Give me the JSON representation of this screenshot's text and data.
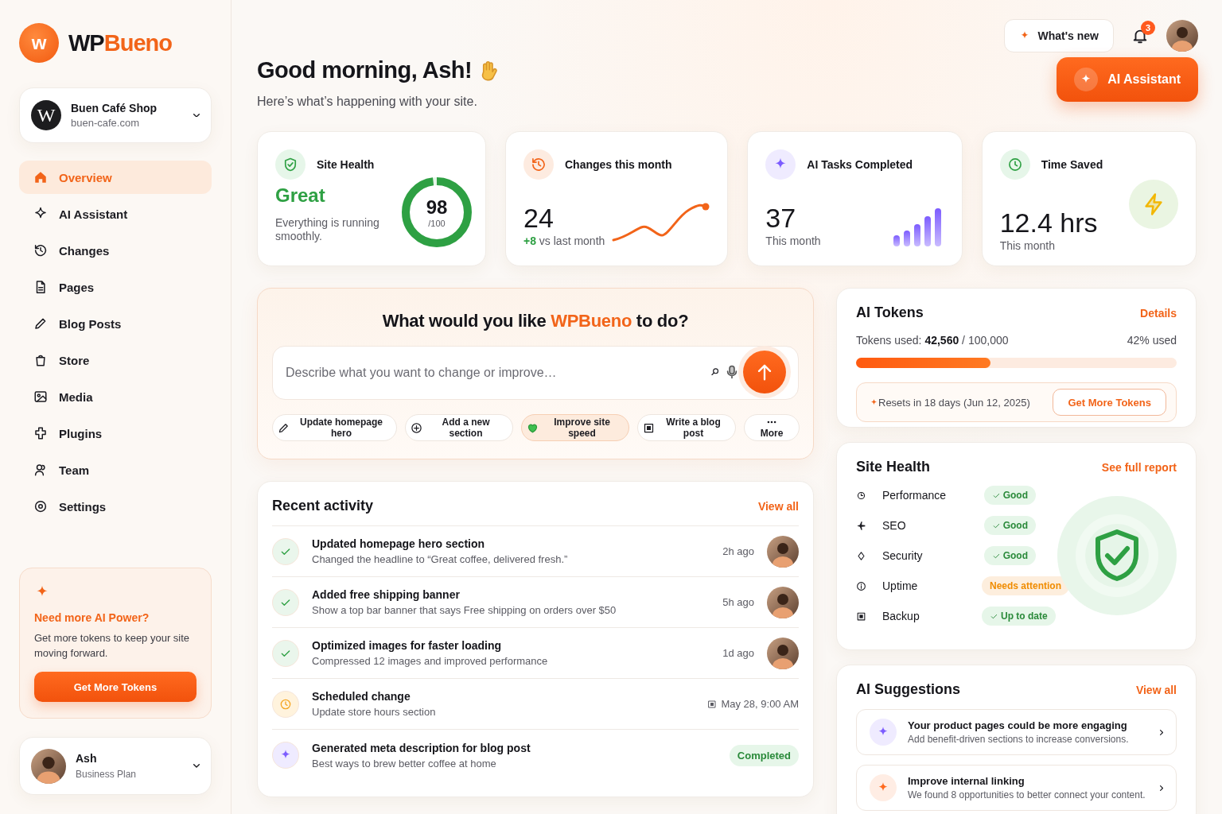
{
  "brand": {
    "logo_letter": "w",
    "name_dark": "WP",
    "name_accent": "Bueno"
  },
  "site": {
    "letter": "W",
    "name": "Buen Café Shop",
    "domain": "buen-cafe.com"
  },
  "nav": [
    {
      "label": "Overview",
      "selected": true
    },
    {
      "label": "AI Assistant",
      "selected": false
    },
    {
      "label": "Changes",
      "selected": false
    },
    {
      "label": "Pages",
      "selected": false
    },
    {
      "label": "Blog Posts",
      "selected": false
    },
    {
      "label": "Store",
      "selected": false
    },
    {
      "label": "Media",
      "selected": false
    },
    {
      "label": "Plugins",
      "selected": false
    },
    {
      "label": "Team",
      "selected": false
    },
    {
      "label": "Settings",
      "selected": false
    }
  ],
  "promo": {
    "title": "Need more AI Power?",
    "text": "Get more tokens to keep your site moving forward.",
    "button": "Get More Tokens"
  },
  "user": {
    "name": "Ash",
    "plan": "Business Plan"
  },
  "header": {
    "greeting": "Good morning, Ash!",
    "subtitle": "Here’s what’s happening with your site.",
    "whats_new": "What's new",
    "notifications": "3",
    "ai_button": "AI Assistant"
  },
  "stats": [
    {
      "kind": "ring",
      "title": "Site Health",
      "value": "Great",
      "caption": "Everything is running smoothly.",
      "score": "98",
      "score_max": "/100",
      "level": 0.98
    },
    {
      "kind": "trend",
      "title": "Changes this month",
      "value": "24",
      "delta": "+8",
      "caption": "vs last month"
    },
    {
      "kind": "bars",
      "title": "AI Tasks Completed",
      "value": "37",
      "caption": "This month"
    },
    {
      "kind": "bolt",
      "title": "Time Saved",
      "value": "12.4 hrs",
      "caption": "This month"
    }
  ],
  "prompt": {
    "title_before": "What would you like",
    "title_brand": "WPBueno",
    "title_after": "to do?",
    "placeholder": "Describe what you want to change or improve…",
    "chips": [
      {
        "label": "Update homepage hero",
        "selected": false
      },
      {
        "label": "Add a new section",
        "selected": false
      },
      {
        "label": "Improve site speed",
        "selected": true
      },
      {
        "label": "Write a blog post",
        "selected": false
      },
      {
        "label": "More",
        "selected": false
      }
    ]
  },
  "activity": {
    "title": "Recent activity",
    "link": "View all",
    "items": [
      {
        "kind": "done",
        "title": "Updated homepage hero section",
        "detail": "Changed the headline to “Great coffee, delivered fresh.”",
        "time": "2h ago"
      },
      {
        "kind": "done",
        "title": "Added free shipping banner",
        "detail": "Show a top bar banner that says Free shipping on orders over $50",
        "time": "5h ago"
      },
      {
        "kind": "done",
        "title": "Optimized images for faster loading",
        "detail": "Compressed 12 images and improved performance",
        "time": "1d ago"
      },
      {
        "kind": "scheduled",
        "title": "Scheduled change",
        "detail": "Update store hours section",
        "time": "May 28, 9:00 AM"
      },
      {
        "kind": "ai",
        "title": "Generated meta description for blog post",
        "detail": "Best ways to brew better coffee at home",
        "status": "Completed"
      }
    ]
  },
  "tokens": {
    "title": "AI Tokens",
    "link": "Details",
    "used_label": "Tokens used:",
    "used": "42,560",
    "total": "/ 100,000",
    "percent": "42% used",
    "level": 0.42,
    "reset": "Resets in 18 days (Jun 12, 2025)",
    "button": "Get More Tokens"
  },
  "health": {
    "title": "Site Health",
    "link": "See full report",
    "checks": [
      {
        "label": "Performance",
        "status": "Good",
        "ok": true
      },
      {
        "label": "SEO",
        "status": "Good",
        "ok": true
      },
      {
        "label": "Security",
        "status": "Good",
        "ok": true
      },
      {
        "label": "Uptime",
        "status": "Needs attention",
        "ok": false
      },
      {
        "label": "Backup",
        "status": "Up to date",
        "ok": true
      }
    ]
  },
  "suggestions": {
    "title": "AI Suggestions",
    "link": "View all",
    "items": [
      {
        "title": "Your product pages could be more engaging",
        "detail": "Add benefit-driven sections to increase conversions.",
        "color": "#7c5cff"
      },
      {
        "title": "Improve internal linking",
        "detail": "We found 8 opportunities to better connect your content.",
        "color": "#ff6a1f"
      }
    ]
  }
}
